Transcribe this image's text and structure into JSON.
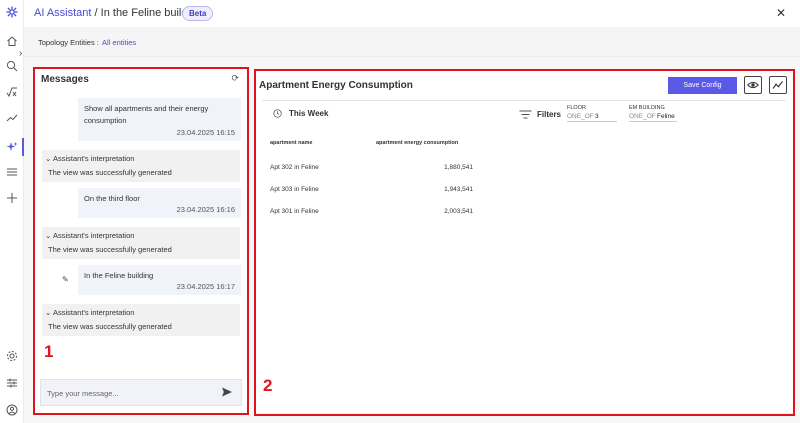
{
  "header": {
    "app_link": "AI Assistant",
    "separator": " / ",
    "page_name": "In the Feline building",
    "badge": "Beta"
  },
  "topology": {
    "label": "Topology Entities :",
    "value": "All entities"
  },
  "messages": {
    "title": "Messages",
    "items": [
      {
        "type": "user",
        "text_line1": "Show all apartments and their energy",
        "text_line2": "consumption",
        "timestamp": "23.04.2025 16:15"
      },
      {
        "type": "assistant",
        "header": "Assistant's interpretation",
        "body": "The view was successfully generated"
      },
      {
        "type": "user",
        "text_line1": "On the third floor",
        "timestamp": "23.04.2025 16:16"
      },
      {
        "type": "assistant",
        "header": "Assistant's interpretation",
        "body": "The view was successfully generated"
      },
      {
        "type": "user",
        "text_line1": "In the Feline building",
        "timestamp": "23.04.2025 16:17"
      },
      {
        "type": "assistant",
        "header": "Assistant's interpretation",
        "body": "The view was successfully generated"
      }
    ],
    "input_placeholder": "Type your message..."
  },
  "annotations": {
    "box1": "1",
    "box2": "2",
    "color": "#e0141e"
  },
  "view": {
    "title": "Apartment Energy Consumption",
    "save_label": "Save Config",
    "period": "This Week",
    "filters_label": "Filters",
    "filters": [
      {
        "label": "FLOOR",
        "operator": "ONE_OF",
        "value": "3"
      },
      {
        "label": "EM BUILDING",
        "operator": "ONE_OF",
        "value": "Feline"
      }
    ],
    "table": {
      "columns": [
        "apartment name",
        "apartment energy consumption"
      ],
      "rows": [
        [
          "Apt 302 in Feline",
          "1,880,541"
        ],
        [
          "Apt 303 in Feline",
          "1,943,541"
        ],
        [
          "Apt 301 in Feline",
          "2,003,541"
        ]
      ]
    }
  },
  "colors": {
    "accent": "#5a5ae6",
    "link": "#4a4ad0"
  }
}
